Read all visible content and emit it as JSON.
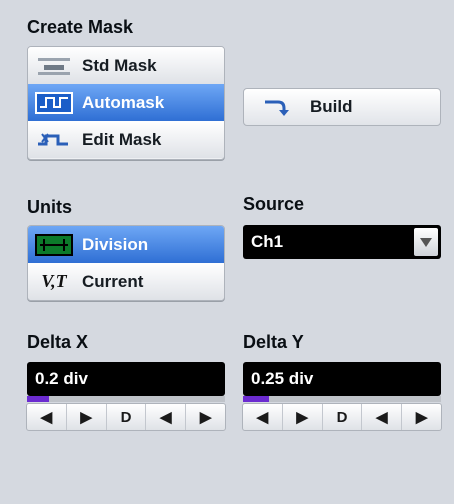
{
  "create_mask": {
    "label": "Create Mask",
    "items": [
      {
        "label": "Std Mask",
        "icon": "std-mask-icon",
        "selected": false
      },
      {
        "label": "Automask",
        "icon": "automask-icon",
        "selected": true
      },
      {
        "label": "Edit Mask",
        "icon": "edit-mask-icon",
        "selected": false
      }
    ],
    "build_label": "Build"
  },
  "units": {
    "label": "Units",
    "items": [
      {
        "label": "Division",
        "icon": "division-icon",
        "selected": true
      },
      {
        "label": "Current",
        "icon": "vt-current-icon",
        "selected": false
      }
    ]
  },
  "source": {
    "label": "Source",
    "value": "Ch1"
  },
  "delta_x": {
    "label": "Delta X",
    "value": "0.2 div",
    "stepper": [
      "◀",
      "▶",
      "D",
      "◀",
      "▶"
    ]
  },
  "delta_y": {
    "label": "Delta Y",
    "value": "0.25 div",
    "stepper": [
      "◀",
      "▶",
      "D",
      "◀",
      "▶"
    ]
  },
  "colors": {
    "selected": "#2f6fd4",
    "field_bg": "#000000",
    "track_fill": "#6b2bd0",
    "panel_bg": "#d5d9e0"
  }
}
